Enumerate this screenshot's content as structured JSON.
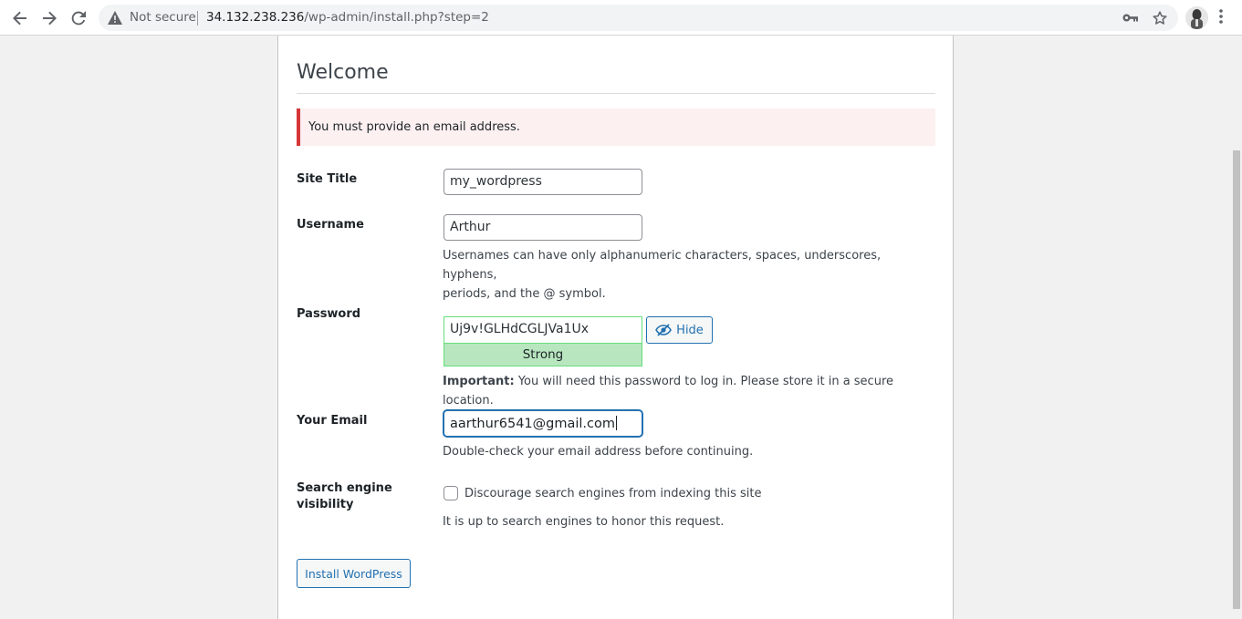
{
  "browser": {
    "security_label": "Not secure",
    "url_host": "34.132.238.236",
    "url_path": "/wp-admin/install.php?step=2"
  },
  "page": {
    "heading": "Welcome",
    "error_notice": "You must provide an email address."
  },
  "form": {
    "site_title": {
      "label": "Site Title",
      "value": "my_wordpress"
    },
    "username": {
      "label": "Username",
      "value": "Arthur",
      "hint_line1": "Usernames can have only alphanumeric characters, spaces, underscores, hyphens,",
      "hint_line2": "periods, and the @ symbol."
    },
    "password": {
      "label": "Password",
      "value": "Uj9v!GLHdCGLJVa1Ux",
      "strength": "Strong",
      "hide_label": "Hide",
      "important_label": "Important:",
      "important_text": " You will need this password to log in. Please store it in a secure location."
    },
    "email": {
      "label": "Your Email",
      "value": "aarthur6541@gmail.com",
      "hint": "Double-check your email address before continuing."
    },
    "visibility": {
      "label_line1": "Search engine",
      "label_line2": "visibility",
      "checkbox_label": "Discourage search engines from indexing this site",
      "checked": false,
      "hint": "It is up to search engines to honor this request."
    },
    "submit_label": "Install WordPress"
  },
  "colors": {
    "accent": "#2271b1",
    "error": "#d63638",
    "strong": "#b8e6bf"
  }
}
